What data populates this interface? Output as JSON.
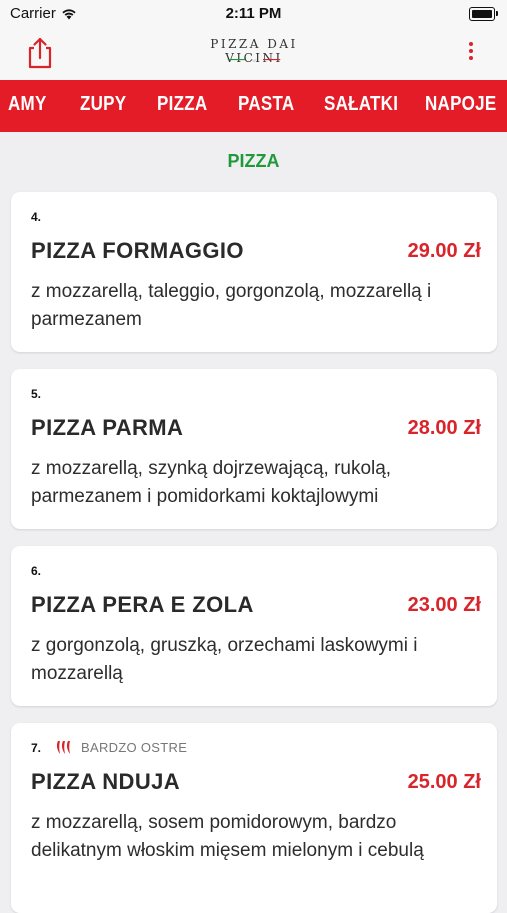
{
  "status_bar": {
    "carrier": "Carrier",
    "time": "2:11 PM"
  },
  "header": {
    "logo_text": "PIZZA DAI VICINI",
    "share_icon": "share-icon",
    "more_icon": "more-vertical-icon"
  },
  "colors": {
    "accent_red": "#e31c27",
    "price_red": "#d8242b",
    "section_green": "#1f9a3b"
  },
  "categories": [
    "AMY",
    "ZUPY",
    "PIZZA",
    "PASTA",
    "SAŁATKI",
    "NAPOJE"
  ],
  "section": {
    "title": "PIZZA"
  },
  "items": [
    {
      "number": "4.",
      "name": "PIZZA FORMAGGIO",
      "price": "29.00 Zł",
      "description": "z mozzarellą, taleggio, gorgonzolą, mozzarellą i parmezanem"
    },
    {
      "number": "5.",
      "name": "PIZZA PARMA",
      "price": "28.00 Zł",
      "description": "z mozzarellą, szynką dojrzewającą, rukolą, parmezanem i pomidorkami koktajlowymi"
    },
    {
      "number": "6.",
      "name": "PIZZA PERA E ZOLA",
      "price": "23.00 Zł",
      "description": "z gorgonzolą, gruszką, orzechami laskowymi i mozzarellą"
    },
    {
      "number": "7.",
      "badge": "BARDZO OSTRE",
      "badge_icon": "chili-peppers-icon",
      "name": "PIZZA NDUJA",
      "price": "25.00 Zł",
      "description": "z mozzarellą, sosem pomidorowym, bardzo delikatnym włoskim mięsem mielonym i cebulą"
    }
  ]
}
